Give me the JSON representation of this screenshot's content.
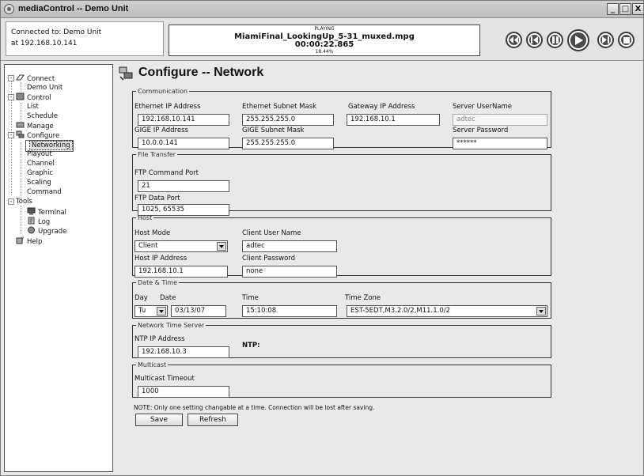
{
  "window": {
    "title": "mediaControl -- Demo Unit",
    "min_label": "_",
    "max_label": "□",
    "close_label": "X"
  },
  "connection": {
    "line1": "Connected to: Demo Unit",
    "line2": "at 192.168.10.141"
  },
  "playback": {
    "state": "PLAYING",
    "file": "MiamiFinal_LookingUp_5-31_muxed.mpg",
    "time": "00:00:22.865",
    "percent_text": "18.44%"
  },
  "transport": [
    "rewind-icon",
    "previous-icon",
    "pause-icon",
    "play-icon",
    "next-icon",
    "stop-icon"
  ],
  "tree": {
    "connect": "Connect",
    "demo_unit": "Demo Unit",
    "control": "Control",
    "list": "List",
    "schedule": "Schedule",
    "manage": "Manage",
    "configure": "Configure",
    "networking": "Networking",
    "playout": "Playout",
    "channel": "Channel",
    "graphic": "Graphic",
    "scaling": "Scaling",
    "command": "Command",
    "tools": "Tools",
    "terminal": "Terminal",
    "log": "Log",
    "upgrade": "Upgrade",
    "help": "Help"
  },
  "page": {
    "title": "Configure -- Network"
  },
  "communication": {
    "legend": "Communication",
    "eth_ip_label": "Ethernet IP Address",
    "eth_ip": "192.168.10.141",
    "eth_mask_label": "Ethernet Subnet Mask",
    "eth_mask": "255.255.255.0",
    "gateway_label": "Gateway IP Address",
    "gateway": "192.168.10.1",
    "server_user_label": "Server UserName",
    "server_user": "adtec",
    "gige_ip_label": "GIGE IP Address",
    "gige_ip": "10.0.0.141",
    "gige_mask_label": "GIGE Subnet Mask",
    "gige_mask": "255.255.255.0",
    "server_pass_label": "Server Password",
    "server_pass": "******"
  },
  "file_transfer": {
    "legend": "File Transfer",
    "ftp_cmd_label": "FTP Command Port",
    "ftp_cmd": "21",
    "ftp_data_label": "FTP Data Port",
    "ftp_data": "1025, 65535"
  },
  "host": {
    "legend": "Host",
    "mode_label": "Host Mode",
    "mode": "Client",
    "client_user_label": "Client User Name",
    "client_user": "adtec",
    "ip_label": "Host IP Address",
    "ip": "192.168.10.1",
    "client_pass_label": "Client Password",
    "client_pass": "none"
  },
  "datetime": {
    "legend": "Date & Time",
    "day_label": "Day",
    "day": "Tu",
    "date_label": "Date",
    "date": "03/13/07",
    "time_label": "Time",
    "time": "15:10:08",
    "tz_label": "Time Zone",
    "tz": "EST-5EDT,M3.2.0/2,M11.1.0/2"
  },
  "ntp": {
    "legend": "Network Time Server",
    "ip_label": "NTP IP Address",
    "ip": "192.168.10.3",
    "status_label": "NTP:"
  },
  "multicast": {
    "legend": "Multicast",
    "timeout_label": "Multicast Timeout",
    "timeout": "1000"
  },
  "footer": {
    "note": "NOTE: Only one setting changable at a time.  Connection will be lost after saving.",
    "save": "Save",
    "refresh": "Refresh"
  }
}
